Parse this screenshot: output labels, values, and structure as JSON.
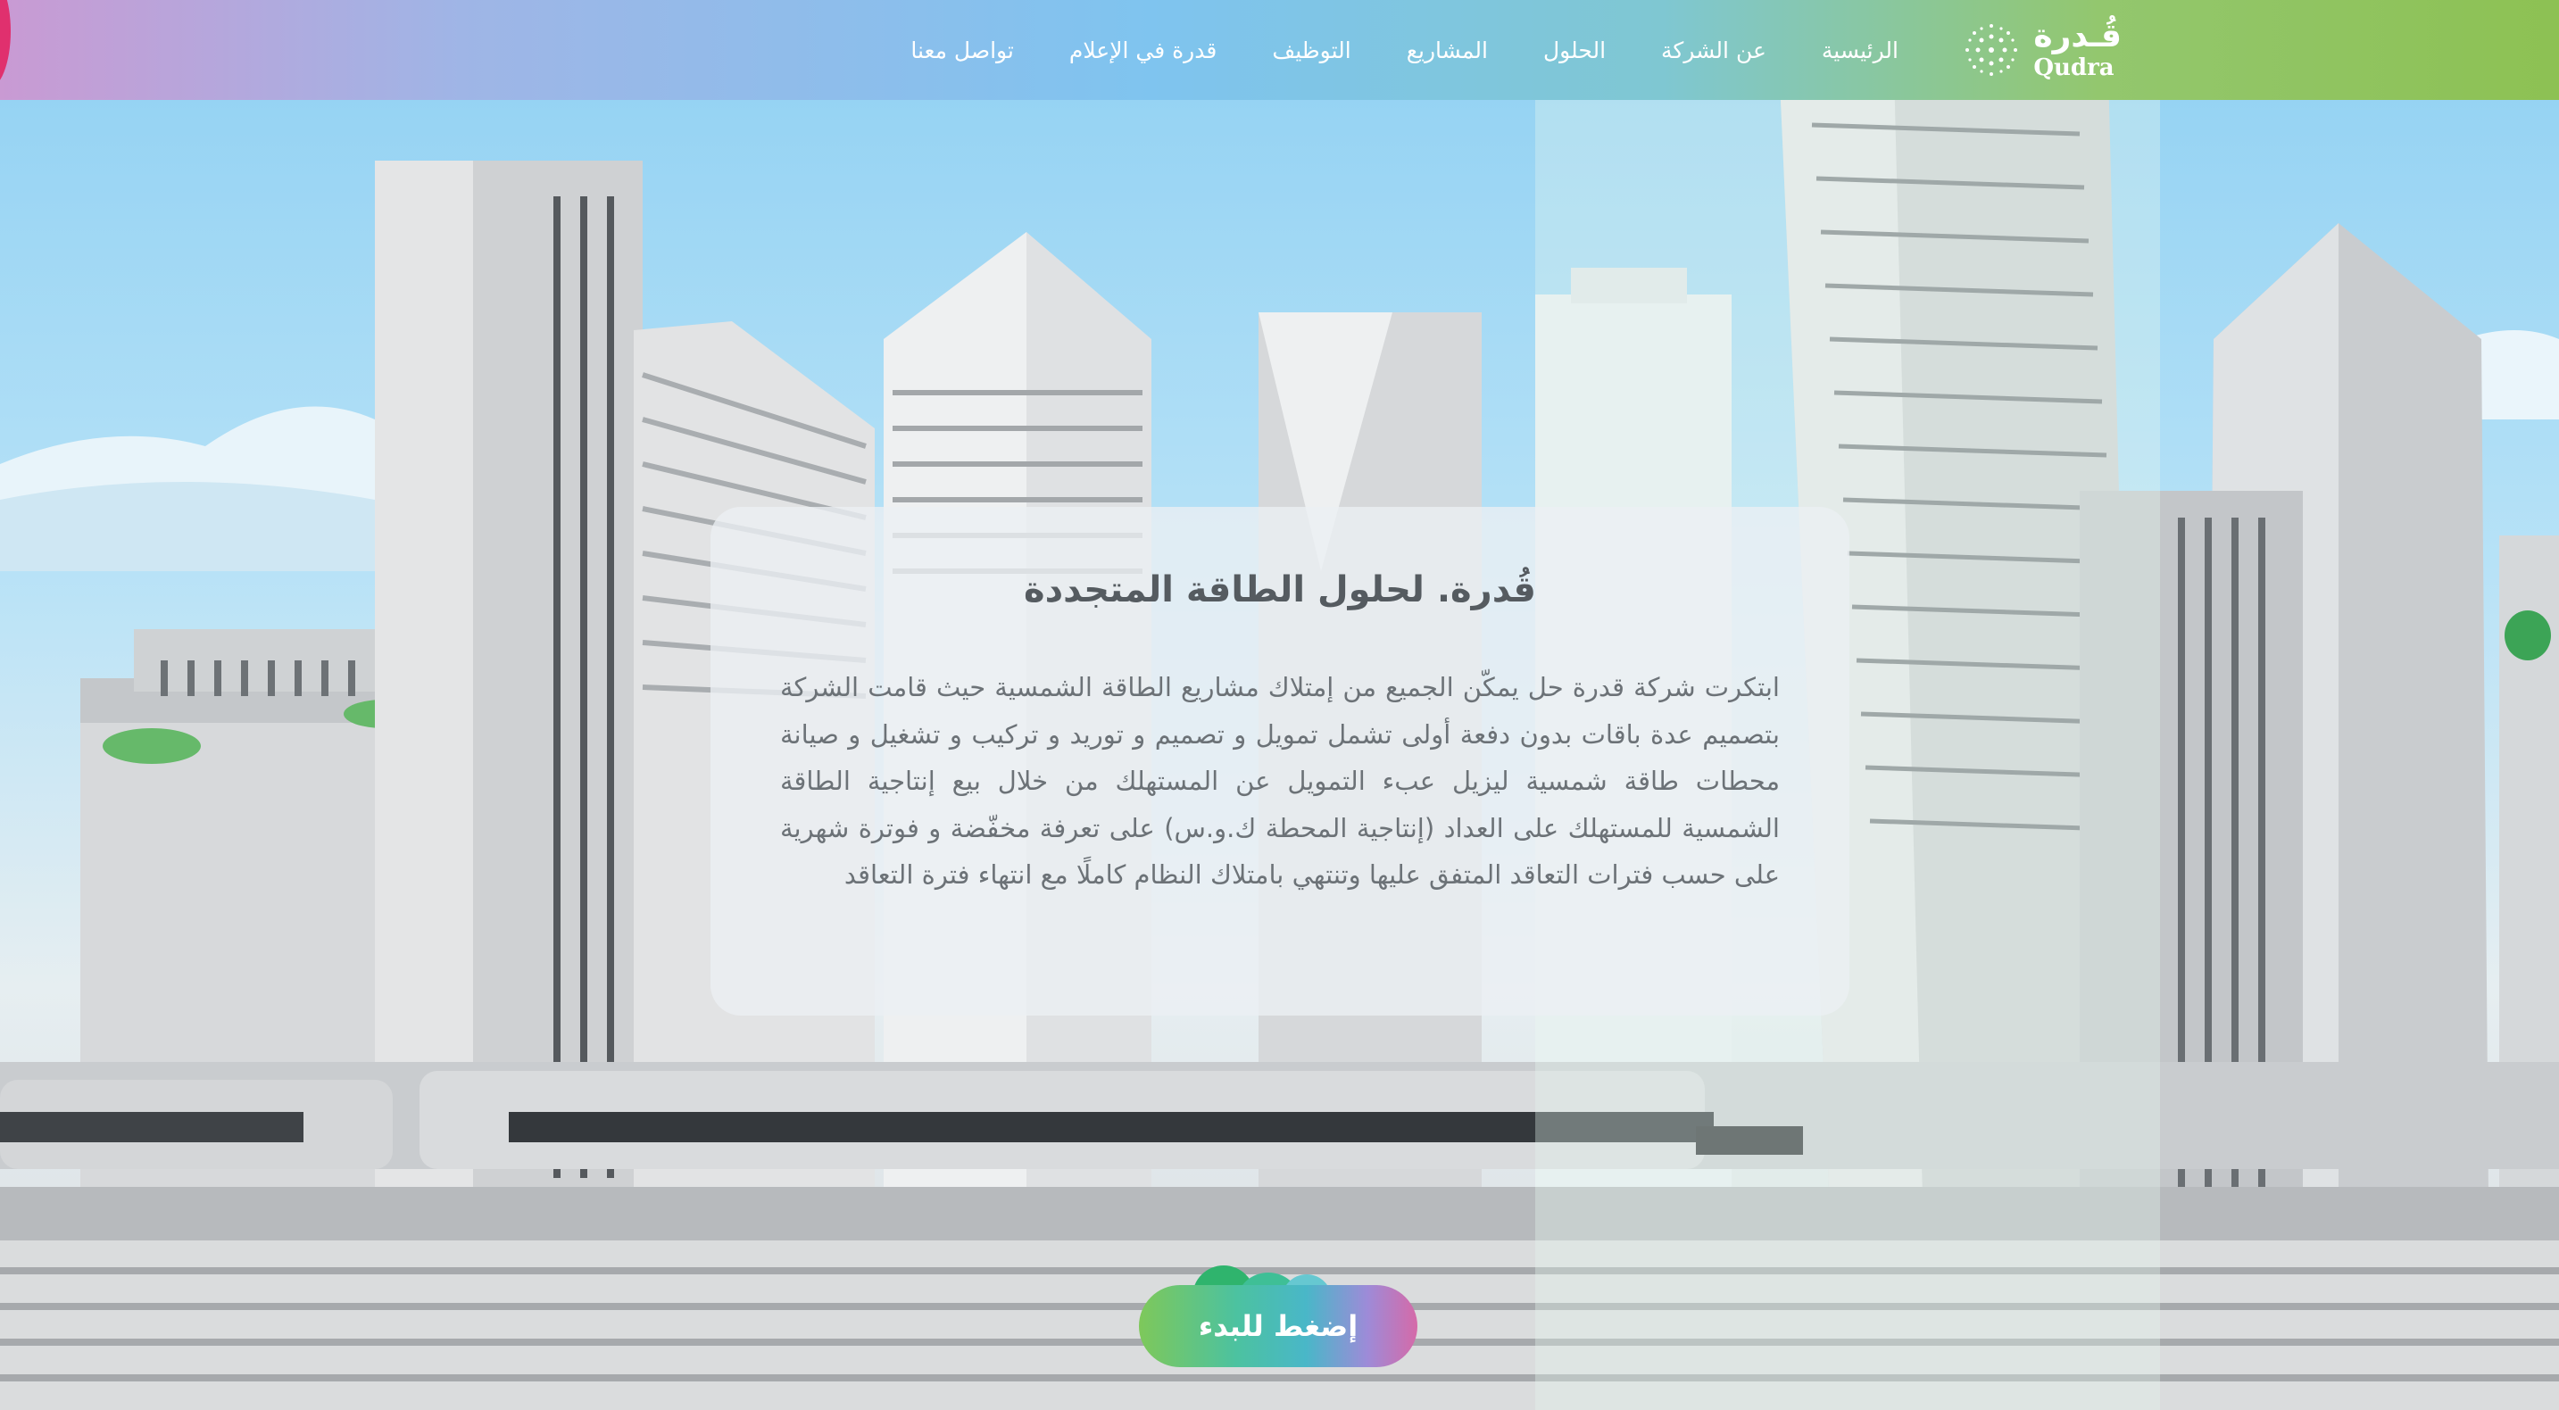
{
  "brand": {
    "name_ar": "قُـدرة",
    "name_en": "Qudra"
  },
  "nav": {
    "items": [
      {
        "label": "الرئيسية"
      },
      {
        "label": "عن الشركة"
      },
      {
        "label": "الحلول"
      },
      {
        "label": "المشاريع"
      },
      {
        "label": "التوظيف"
      },
      {
        "label": "قدرة في الإعلام"
      },
      {
        "label": "تواصل معنا"
      }
    ]
  },
  "hero": {
    "title": "قُدرة. لحلول الطاقة المتجددة",
    "body": "ابتكرت شركة قدرة حل يمكّن الجميع من إمتلاك مشاريع الطاقة الشمسية حيث قامت الشركة بتصميم عدة باقات بدون دفعة أولى تشمل تمويل و تصميم و توريد و تركيب و تشغيل و صيانة محطات طاقة شمسية ليزيل عبء التمويل عن المستهلك من خلال بيع إنتاجية الطاقة الشمسية للمستهلك على العداد (إنتاجية المحطة ك.و.س) على تعرفة مخفّضة و فوترة شهرية على حسب فترات التعاقد المتفق عليها وتنتهي بامتلاك النظام كاملًا مع انتهاء فترة التعاقد",
    "cta_label": "إضغط للبدء"
  },
  "colors": {
    "accent_pink": "#e0306e",
    "accent_green": "#8dc153",
    "accent_blue": "#7fc4ef",
    "title_text": "#555b60",
    "body_text": "#6c7277"
  }
}
